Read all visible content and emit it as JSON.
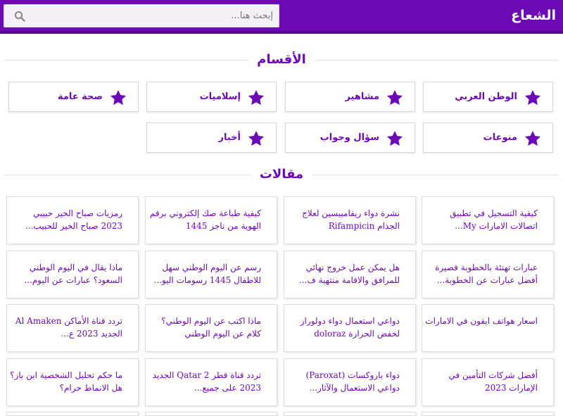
{
  "header": {
    "site_title": "الشعاع",
    "search_placeholder": "إبحث هنا..."
  },
  "sections": {
    "categories_title": "الأقسام",
    "articles_title": "مقالات"
  },
  "categories": [
    {
      "label": "الوطن العربي"
    },
    {
      "label": "مشاهير"
    },
    {
      "label": "إسلاميات"
    },
    {
      "label": "صحة عامة"
    },
    {
      "label": "منوعات"
    },
    {
      "label": "سؤال وجواب"
    },
    {
      "label": "أخبار"
    }
  ],
  "articles": [
    {
      "title": "كيفية التسجيل في تطبيق اتصالات الامارات My..."
    },
    {
      "title": "نشرة دواء ريفامبيسين لعلاج الجذام Rifampicin"
    },
    {
      "title": "كيفية طباعة صك إلكتروني برقم الهوية من ناجز 1445"
    },
    {
      "title": "رمزيات صباح الخير حبيبي 2023 صباح الخير للحبيب..."
    },
    {
      "title": "عبارات تهنئة بالخطوبة قصيرة أفضل عبارات عن الخطوبة..."
    },
    {
      "title": "هل يمكن عمل خروج نهائي للمرافق والاقامة منتهية ف..."
    },
    {
      "title": "رسم عن اليوم الوطني سهل للاطفال 1445 رسومات اليو..."
    },
    {
      "title": "ماذا يقال في اليوم الوطني السعود؟ عبارات عن اليوم..."
    },
    {
      "title": "اسعار هواتف ايفون في الامارات"
    },
    {
      "title": "دواعي استعمال دواء دولوراز لخفض الحرارة doloraz"
    },
    {
      "title": "ماذا اكتب عن اليوم الوطني؟ كلام عن اليوم الوطني"
    },
    {
      "title": "تردد قناة الأماكن Al Amaken الجديد 2023 ع..."
    },
    {
      "title": "أفضل شركات التأمين في الإمارات 2023"
    },
    {
      "title": "دواء باروكسات (Paroxat) دواعي الاستعمال والآثار..."
    },
    {
      "title": "تردد قناة قطر Qatar 2 الجديد 2023 على جميع..."
    },
    {
      "title": "ما حكم تحليل الشخصية ابن باز؟ هل الانماط حرام؟"
    }
  ],
  "colors": {
    "brand": "#6c0ab5",
    "header_bg": "#6c0ab5",
    "card_border": "#dedede"
  },
  "icons": {
    "category": "star-icon",
    "search": "search-icon"
  }
}
